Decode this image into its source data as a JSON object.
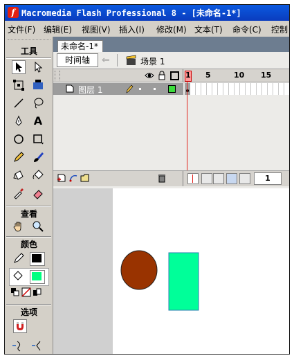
{
  "window": {
    "app_icon": "flash-app-icon",
    "title": "Macromedia Flash Professional 8 - [未命名-1*]"
  },
  "menubar": {
    "items": [
      "文件(F)",
      "编辑(E)",
      "视图(V)",
      "插入(I)",
      "修改(M)",
      "文本(T)",
      "命令(C)",
      "控制"
    ]
  },
  "tools": {
    "header": "工具",
    "view_header": "查看",
    "color_header": "颜色",
    "options_header": "选项",
    "icons": [
      "selection-arrow-icon",
      "subselection-icon",
      "free-transform-icon",
      "fill-transform-icon",
      "line-icon",
      "lasso-icon",
      "pen-icon",
      "text-icon",
      "oval-icon",
      "rectangle-icon",
      "pencil-icon",
      "brush-icon",
      "ink-bottle-icon",
      "paint-bucket-icon",
      "eyedropper-icon",
      "eraser-icon",
      "hand-icon",
      "zoom-icon"
    ],
    "stroke_color": "#000000",
    "fill_color": "#00ff80"
  },
  "document": {
    "tab_label": "未命名-1*",
    "timeline_button": "时间轴",
    "scene_label": "场景 1"
  },
  "timeline": {
    "frame_numbers": [
      "1",
      "5",
      "10",
      "15"
    ],
    "layer_name": "图层 1",
    "current_frame": "1",
    "playhead_color": "#e0201a"
  },
  "stage": {
    "circle_color": "#993300",
    "rect_color": "#00ff99"
  }
}
